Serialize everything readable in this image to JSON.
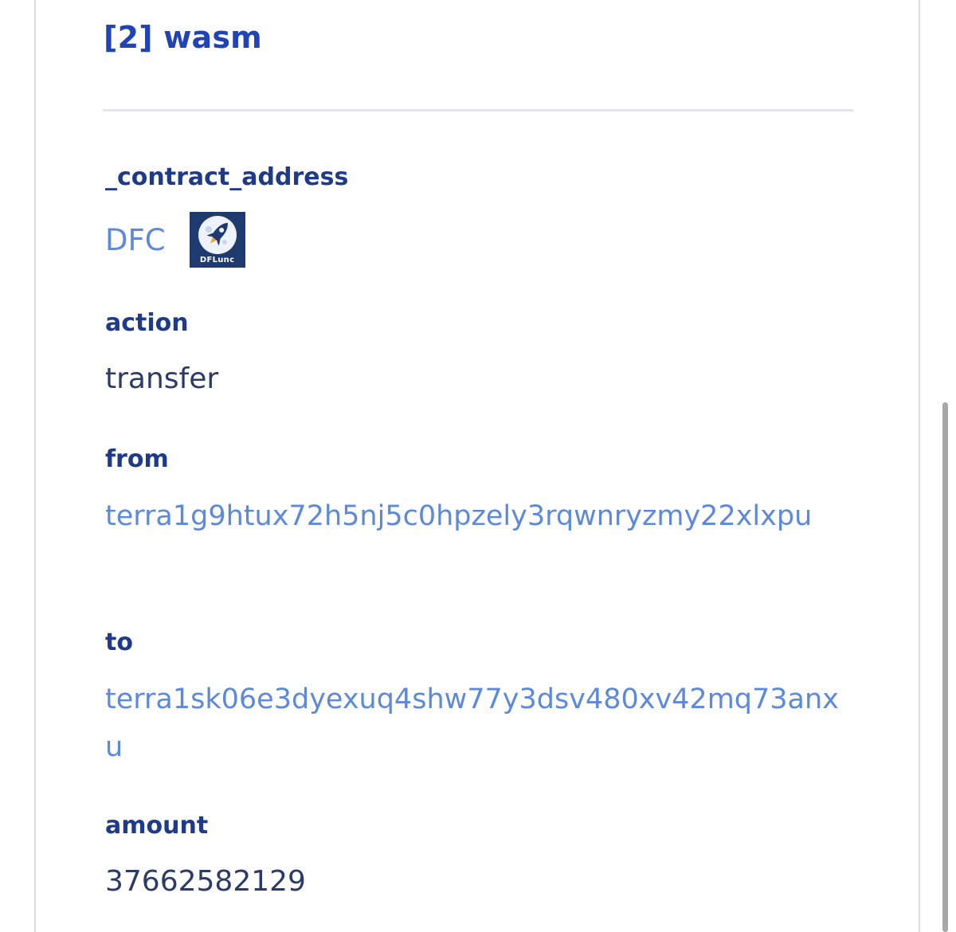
{
  "message": {
    "title": "[2] wasm"
  },
  "fields": {
    "contract_address": {
      "label": "_contract_address",
      "token_symbol": "DFC",
      "token_logo_icon": "rocket-moon-logo-icon",
      "token_logo_text": "DFLunc"
    },
    "action": {
      "label": "action",
      "value": "transfer"
    },
    "from": {
      "label": "from",
      "value": "terra1g9htux72h5nj5c0hpzely3rqwnryzmy22xlxpu"
    },
    "to": {
      "label": "to",
      "value": "terra1sk06e3dyexuq4shw77y3dsv480xv42mq73anxu"
    },
    "amount": {
      "label": "amount",
      "value": "37662582129"
    }
  },
  "colors": {
    "title": "#2043b5",
    "label": "#1e3a8a",
    "link": "#5d89db",
    "text": "#2b3a66",
    "divider": "#e3e5f2",
    "logo_bg": "#1f3a6e"
  }
}
